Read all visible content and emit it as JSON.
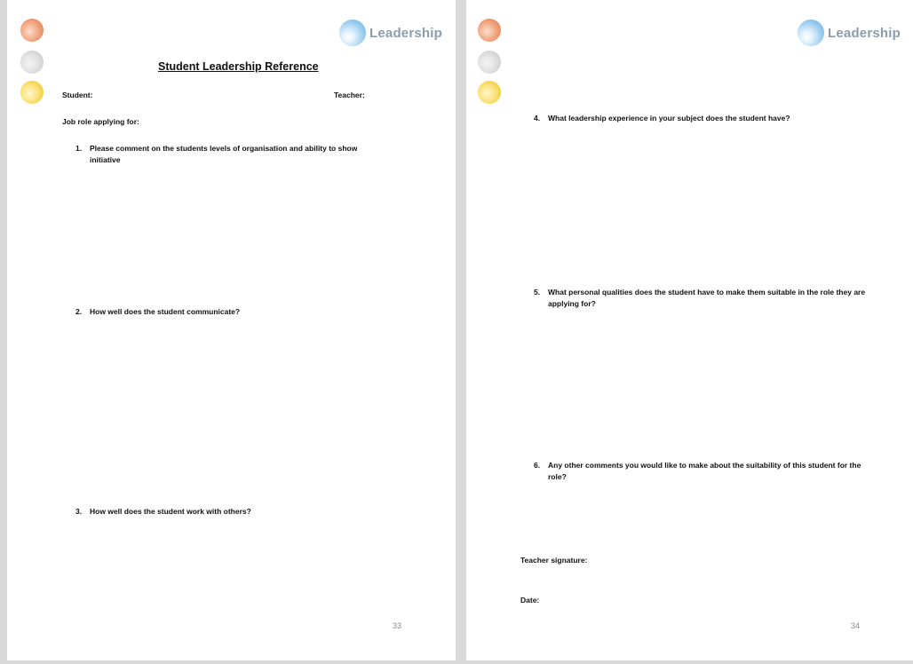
{
  "brand": "Leadership",
  "page_left": {
    "title": "Student Leadership Reference",
    "student_label": "Student:",
    "teacher_label": "Teacher:",
    "job_role_label": "Job role applying for:",
    "questions": [
      {
        "num": "1.",
        "text": "Please comment on the students levels of organisation and ability to show initiative"
      },
      {
        "num": "2.",
        "text": "How well does the student communicate?"
      },
      {
        "num": "3.",
        "text": "How well does the student work with others?"
      }
    ],
    "page_number": "33"
  },
  "page_right": {
    "questions": [
      {
        "num": "4.",
        "text": "What leadership experience in your subject does the student have?"
      },
      {
        "num": "5.",
        "text": "What personal qualities does the student have to make them suitable in the role they are applying for?"
      },
      {
        "num": "6.",
        "text": "Any other comments you would like to make about the suitability of this student for the role?"
      }
    ],
    "signature_label": "Teacher signature:",
    "date_label": "Date:",
    "page_number": "34"
  }
}
